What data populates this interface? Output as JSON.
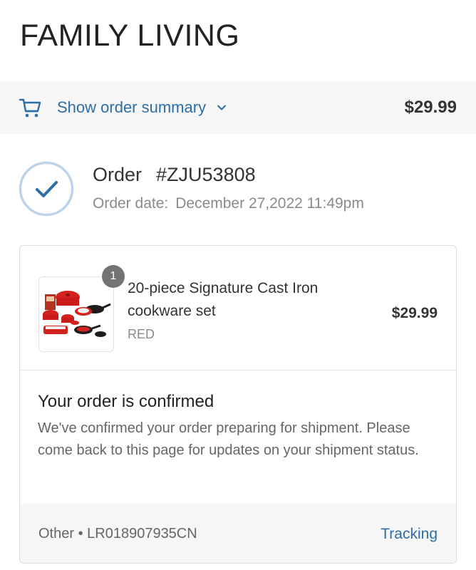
{
  "store": {
    "name": "FAMILY LIVING"
  },
  "summary": {
    "toggle_label": "Show order summary",
    "total": "$29.99",
    "icon": "cart-icon",
    "accent_color": "#2c6ea7"
  },
  "order": {
    "label": "Order",
    "number": "#ZJU53808",
    "date_label": "Order date:",
    "date_value": "December 27,2022 11:49pm",
    "status_icon": "check-circle-icon"
  },
  "product": {
    "quantity": "1",
    "name": "20-piece Signature Cast Iron cookware set",
    "variant": "RED",
    "price": "$29.99"
  },
  "confirmation": {
    "title": "Your order is confirmed",
    "message": "We've confirmed your order preparing for shipment. Please come back to this page for updates on your shipment status."
  },
  "shipping": {
    "carrier": "Other • LR018907935CN",
    "tracking_label": "Tracking"
  }
}
